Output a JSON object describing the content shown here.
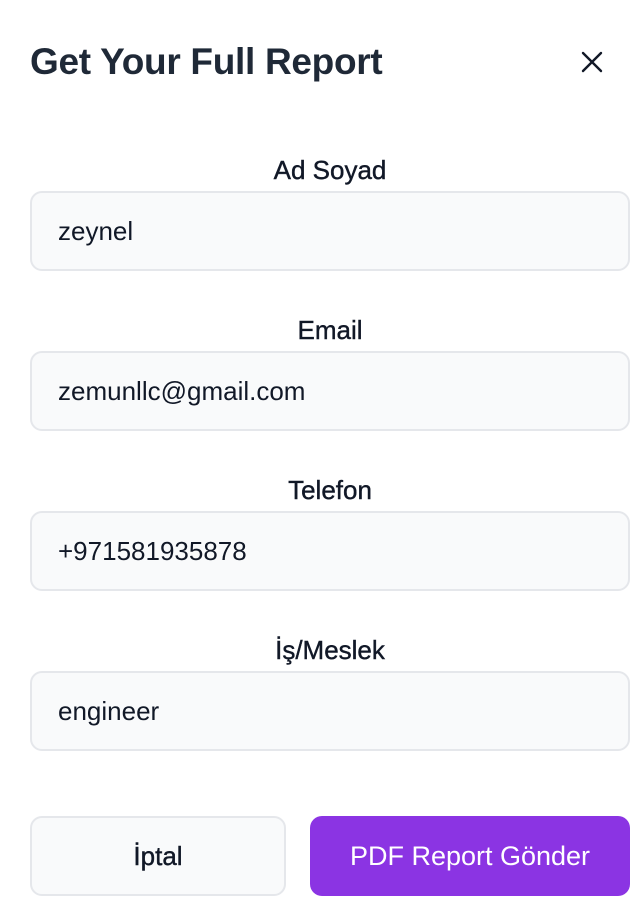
{
  "modal": {
    "title": "Get Your Full Report",
    "close_icon": "close-icon"
  },
  "form": {
    "fields": [
      {
        "label": "Ad Soyad",
        "value": "zeynel"
      },
      {
        "label": "Email",
        "value": "zemunllc@gmail.com"
      },
      {
        "label": "Telefon",
        "value": "+971581935878"
      },
      {
        "label": "İş/Meslek",
        "value": "engineer"
      }
    ]
  },
  "actions": {
    "cancel_label": "İptal",
    "submit_label": "PDF Report Gönder"
  },
  "colors": {
    "primary": "#8b34e3",
    "input_bg": "#f9fafb",
    "border": "#e5e7eb",
    "title": "#1f2937"
  }
}
